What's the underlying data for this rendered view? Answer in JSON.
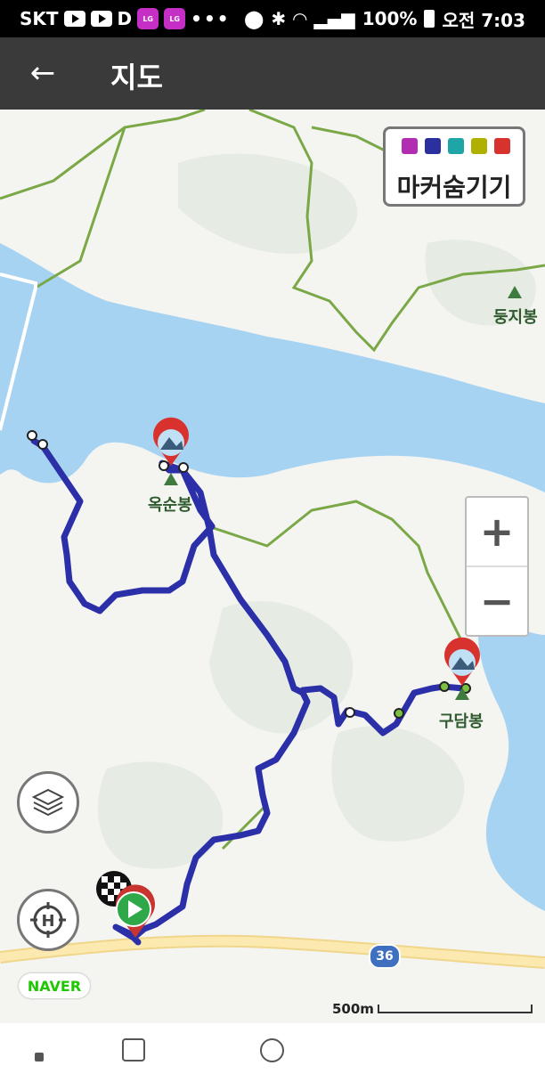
{
  "status": {
    "carrier": "SKT",
    "battery": "100%",
    "time": "오전 7:03",
    "more": "•••"
  },
  "appbar": {
    "title": "지도"
  },
  "map": {
    "marker_toggle_label": "마커숨기기",
    "peaks": [
      {
        "name": "둥지봉"
      },
      {
        "name": "옥순봉"
      },
      {
        "name": "구담봉"
      }
    ],
    "road_number": "36",
    "scale": "500m",
    "attribution": "NAVER"
  },
  "colors": {
    "route": "#2b2fa8",
    "water": "#a7d3f2",
    "land": "#f4f4f1",
    "forest": "#e6ece3",
    "trail": "#7aa847",
    "appbar": "#3a3a3a"
  }
}
